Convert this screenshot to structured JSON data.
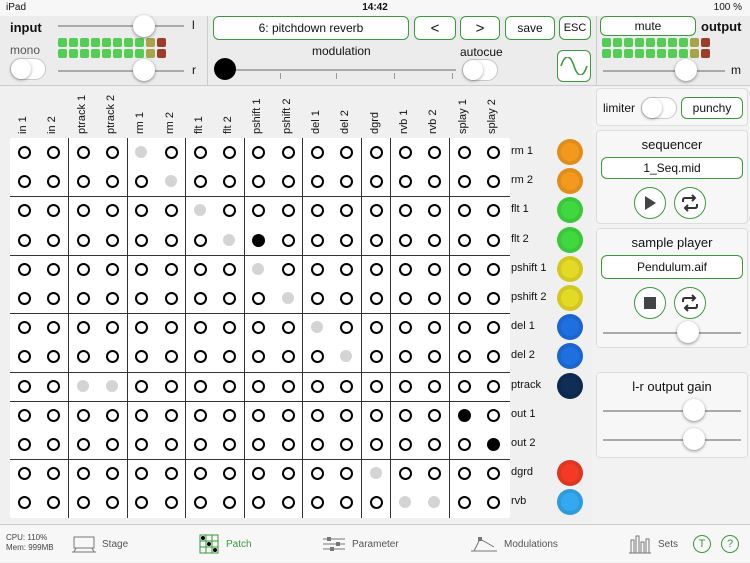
{
  "status": {
    "device": "iPad",
    "time": "14:42",
    "battery": "100 %"
  },
  "input": {
    "label": "input",
    "mono_label": "mono",
    "l_label": "l",
    "r_label": "r"
  },
  "output": {
    "label": "output",
    "m_label": "m",
    "mute_label": "mute"
  },
  "preset": {
    "name": "6: pitchdown reverb",
    "prev": "<",
    "next": ">",
    "save": "save",
    "esc": "ESC"
  },
  "modulation": {
    "label": "modulation",
    "autocue": "autocue"
  },
  "matrix": {
    "columns": [
      "in 1",
      "in 2",
      "ptrack 1",
      "ptrack 2",
      "rm 1",
      "rm 2",
      "flt 1",
      "flt 2",
      "pshift 1",
      "pshift 2",
      "del 1",
      "del 2",
      "dgrd",
      "rvb 1",
      "rvb 2",
      "splay 1",
      "splay 2"
    ],
    "rows": [
      {
        "label": "rm 1",
        "color": "#f39a1e",
        "cells": "0000g000000000000"
      },
      {
        "label": "rm 2",
        "color": "#f39a1e",
        "cells": "00000g00000000000"
      },
      {
        "label": "flt 1",
        "color": "#3fd83f",
        "cells": "000000g0000000000"
      },
      {
        "label": "flt 2",
        "color": "#3fd83f",
        "cells": "0000000gb00000000"
      },
      {
        "label": "pshift 1",
        "color": "#e4d925",
        "cells": "00000000g00000000"
      },
      {
        "label": "pshift 2",
        "color": "#e4d925",
        "cells": "000000000g0000000"
      },
      {
        "label": "del 1",
        "color": "#1e6fe0",
        "cells": "0000000000g000000"
      },
      {
        "label": "del 2",
        "color": "#1e6fe0",
        "cells": "00000000000g00000"
      },
      {
        "label": "ptrack",
        "color": "#0f2d55",
        "cells": "00gg0000000000000"
      },
      {
        "label": "out 1",
        "color": "",
        "cells": "000000000000000b0"
      },
      {
        "label": "out 2",
        "color": "",
        "cells": "0000000000000000b"
      },
      {
        "label": "dgrd",
        "color": "#f23a24",
        "cells": "000000000000g0000"
      },
      {
        "label": "rvb",
        "color": "#33a9f0",
        "cells": "0000000000000gg00"
      }
    ]
  },
  "side": {
    "limiter": "limiter",
    "punchy": "punchy",
    "sequencer_title": "sequencer",
    "sequencer_file": "1_Seq.mid",
    "sample_title": "sample player",
    "sample_file": "Pendulum.aif",
    "gain_title": "l-r output gain"
  },
  "footer": {
    "cpu": "CPU: 110%",
    "mem": "Mem: 999MB",
    "tabs": [
      "Stage",
      "Patch",
      "Parameter",
      "Modulations",
      "Sets"
    ],
    "active_tab": "Patch",
    "t_btn": "T",
    "help_btn": "?"
  }
}
